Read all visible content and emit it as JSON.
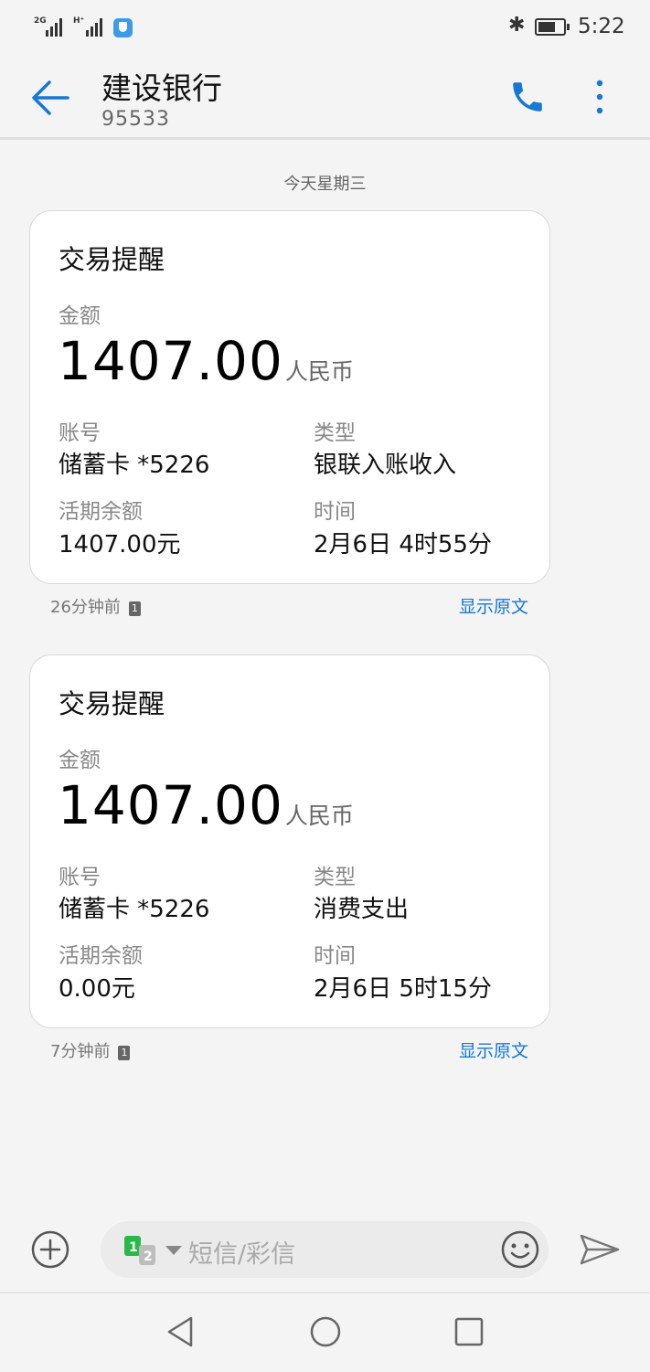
{
  "status_bar": {
    "sim1_label": "2G",
    "sim2_label": "H⁺",
    "time": "5:22"
  },
  "header": {
    "contact_name": "建设银行",
    "contact_number": "95533"
  },
  "date_separator": "今天星期三",
  "messages": [
    {
      "title": "交易提醒",
      "amount_label": "金额",
      "amount": "1407.00",
      "currency": "人民币",
      "account_label": "账号",
      "account": "储蓄卡 *5226",
      "type_label": "类型",
      "type": "银联入账收入",
      "balance_label": "活期余额",
      "balance": "1407.00元",
      "time_label": "时间",
      "time": "2月6日 4时55分",
      "received": "26分钟前",
      "sim": "1",
      "show_original": "显示原文"
    },
    {
      "title": "交易提醒",
      "amount_label": "金额",
      "amount": "1407.00",
      "currency": "人民币",
      "account_label": "账号",
      "account": "储蓄卡 *5226",
      "type_label": "类型",
      "type": "消费支出",
      "balance_label": "活期余额",
      "balance": "0.00元",
      "time_label": "时间",
      "time": "2月6日 5时15分",
      "received": "7分钟前",
      "sim": "1",
      "show_original": "显示原文"
    }
  ],
  "composer": {
    "placeholder": "短信/彩信"
  },
  "colors": {
    "accent": "#1678d2",
    "background": "#f4f4f4",
    "card": "#ffffff"
  },
  "icons": [
    "back-arrow-icon",
    "phone-icon",
    "more-vertical-icon",
    "add-icon",
    "sim-select-icon",
    "emoji-icon",
    "send-icon",
    "nav-back-icon",
    "nav-home-icon",
    "nav-recents-icon"
  ]
}
